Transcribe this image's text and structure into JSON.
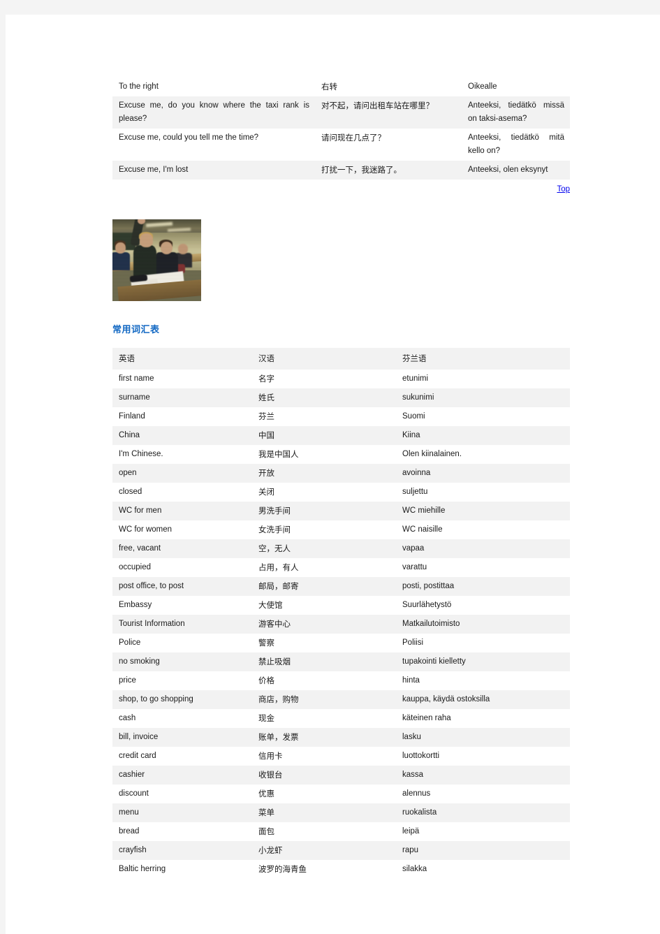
{
  "phrase_table": {
    "rows": [
      {
        "en": "To the right",
        "zh": "右转",
        "fi": "Oikealle"
      },
      {
        "en": "Excuse me, do you know where the taxi rank is please?",
        "zh": "对不起，请问出租车站在哪里？",
        "fi": "Anteeksi, tiedätkö missä on taksi-asema?"
      },
      {
        "en": "Excuse me, could you tell me the time?",
        "zh": "请问现在几点了？",
        "fi": "Anteeksi, tiedätkö mitä kello on?"
      },
      {
        "en": "Excuse me, I'm lost",
        "zh": "打扰一下，我迷路了。",
        "fi": "Anteeksi, olen eksynyt"
      }
    ]
  },
  "top_link": {
    "label": "Top"
  },
  "photo": {
    "alt": "classroom-photo"
  },
  "section": {
    "heading": "常用词汇表"
  },
  "vocab_table": {
    "headers": {
      "en": "英语",
      "zh": "汉语",
      "fi": "芬兰语"
    },
    "rows": [
      {
        "en": "first name",
        "zh": "名字",
        "fi": "etunimi"
      },
      {
        "en": "surname",
        "zh": "姓氏",
        "fi": "sukunimi"
      },
      {
        "en": "Finland",
        "zh": "芬兰",
        "fi": "Suomi"
      },
      {
        "en": "China",
        "zh": "中国",
        "fi": "Kiina"
      },
      {
        "en": "I'm Chinese.",
        "zh": "我是中国人",
        "fi": "Olen kiinalainen."
      },
      {
        "en": "open",
        "zh": "开放",
        "fi": "avoinna"
      },
      {
        "en": "closed",
        "zh": "关闭",
        "fi": "suljettu"
      },
      {
        "en": "WC for men",
        "zh": "男洗手间",
        "fi": "WC miehille"
      },
      {
        "en": "WC for women",
        "zh": "女洗手间",
        "fi": "WC naisille"
      },
      {
        "en": "free, vacant",
        "zh": "空，无人",
        "fi": "vapaa"
      },
      {
        "en": "occupied",
        "zh": "占用，有人",
        "fi": "varattu"
      },
      {
        "en": "post office, to post",
        "zh": "邮局，邮寄",
        "fi": "posti, postittaa"
      },
      {
        "en": "Embassy",
        "zh": "大使馆",
        "fi": "Suurlähetystö"
      },
      {
        "en": "Tourist Information",
        "zh": "游客中心",
        "fi": "Matkailutoimisto"
      },
      {
        "en": "Police",
        "zh": "警察",
        "fi": "Poliisi"
      },
      {
        "en": "no smoking",
        "zh": "禁止吸烟",
        "fi": "tupakointi kielletty"
      },
      {
        "en": "price",
        "zh": "价格",
        "fi": "hinta"
      },
      {
        "en": "shop, to go shopping",
        "zh": "商店，购物",
        "fi": "kauppa, käydä ostoksilla"
      },
      {
        "en": "cash",
        "zh": "现金",
        "fi": "käteinen raha"
      },
      {
        "en": "bill, invoice",
        "zh": "账单，发票",
        "fi": "lasku"
      },
      {
        "en": "credit card",
        "zh": "信用卡",
        "fi": "luottokortti"
      },
      {
        "en": "cashier",
        "zh": "收银台",
        "fi": "kassa"
      },
      {
        "en": "discount",
        "zh": "优惠",
        "fi": "alennus"
      },
      {
        "en": "menu",
        "zh": "菜单",
        "fi": "ruokalista"
      },
      {
        "en": "bread",
        "zh": "面包",
        "fi": "leipä"
      },
      {
        "en": "crayfish",
        "zh": "小龙虾",
        "fi": "rapu"
      },
      {
        "en": "Baltic herring",
        "zh": "波罗的海青鱼",
        "fi": "silakka"
      }
    ]
  },
  "colors": {
    "page_background": "#ffffff",
    "viewer_background": "#f4f4f4",
    "stripe": "#f2f2f2",
    "link": "#0000ee",
    "heading": "#1268c3",
    "text": "#1a1a1a"
  }
}
